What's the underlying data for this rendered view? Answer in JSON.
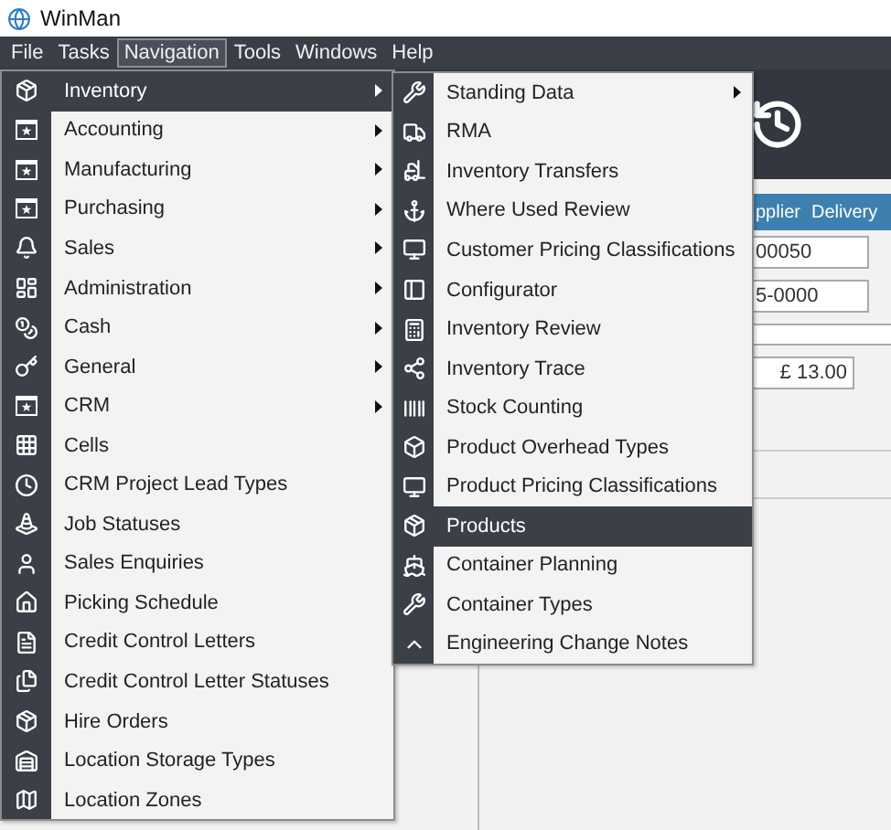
{
  "window": {
    "title": "WinMan"
  },
  "menu_bar": [
    {
      "label": "File",
      "selected": false
    },
    {
      "label": "Tasks",
      "selected": false
    },
    {
      "label": "Navigation",
      "selected": true
    },
    {
      "label": "Tools",
      "selected": false
    },
    {
      "label": "Windows",
      "selected": false
    },
    {
      "label": "Help",
      "selected": false
    }
  ],
  "navigation_menu": [
    {
      "label": "Inventory",
      "submenu": true,
      "selected": true
    },
    {
      "label": "Accounting",
      "submenu": true,
      "selected": false
    },
    {
      "label": "Manufacturing",
      "submenu": true,
      "selected": false
    },
    {
      "label": "Purchasing",
      "submenu": true,
      "selected": false
    },
    {
      "label": "Sales",
      "submenu": true,
      "selected": false
    },
    {
      "label": "Administration",
      "submenu": true,
      "selected": false
    },
    {
      "label": "Cash",
      "submenu": true,
      "selected": false
    },
    {
      "label": "General",
      "submenu": true,
      "selected": false
    },
    {
      "label": "CRM",
      "submenu": true,
      "selected": false
    },
    {
      "label": "Cells",
      "submenu": false,
      "selected": false
    },
    {
      "label": "CRM Project Lead Types",
      "submenu": false,
      "selected": false
    },
    {
      "label": "Job Statuses",
      "submenu": false,
      "selected": false
    },
    {
      "label": "Sales Enquiries",
      "submenu": false,
      "selected": false
    },
    {
      "label": "Picking Schedule",
      "submenu": false,
      "selected": false
    },
    {
      "label": "Credit Control Letters",
      "submenu": false,
      "selected": false
    },
    {
      "label": "Credit Control Letter Statuses",
      "submenu": false,
      "selected": false
    },
    {
      "label": "Hire Orders",
      "submenu": false,
      "selected": false
    },
    {
      "label": "Location Storage Types",
      "submenu": false,
      "selected": false
    },
    {
      "label": "Location Zones",
      "submenu": false,
      "selected": false
    }
  ],
  "inventory_submenu": [
    {
      "label": "Standing Data",
      "submenu": true,
      "selected": false
    },
    {
      "label": "RMA",
      "submenu": false,
      "selected": false
    },
    {
      "label": "Inventory Transfers",
      "submenu": false,
      "selected": false
    },
    {
      "label": "Where Used Review",
      "submenu": false,
      "selected": false
    },
    {
      "label": "Customer Pricing Classifications",
      "submenu": false,
      "selected": false
    },
    {
      "label": "Configurator",
      "submenu": false,
      "selected": false
    },
    {
      "label": "Inventory Review",
      "submenu": false,
      "selected": false
    },
    {
      "label": "Inventory Trace",
      "submenu": false,
      "selected": false
    },
    {
      "label": "Stock Counting",
      "submenu": false,
      "selected": false
    },
    {
      "label": "Product Overhead Types",
      "submenu": false,
      "selected": false
    },
    {
      "label": "Product Pricing Classifications",
      "submenu": false,
      "selected": false
    },
    {
      "label": "Products",
      "submenu": false,
      "selected": true
    },
    {
      "label": "Container Planning",
      "submenu": false,
      "selected": false
    },
    {
      "label": "Container Types",
      "submenu": false,
      "selected": false
    },
    {
      "label": "Engineering Change Notes",
      "submenu": false,
      "selected": false
    }
  ],
  "tab_strip": [
    "pplier",
    "Delivery"
  ],
  "form_fields": [
    {
      "value": "00050",
      "kind": "text"
    },
    {
      "value": "5-0000",
      "kind": "text"
    },
    {
      "kind": "wide"
    },
    {
      "value": "£ 13.00",
      "kind": "money"
    }
  ]
}
